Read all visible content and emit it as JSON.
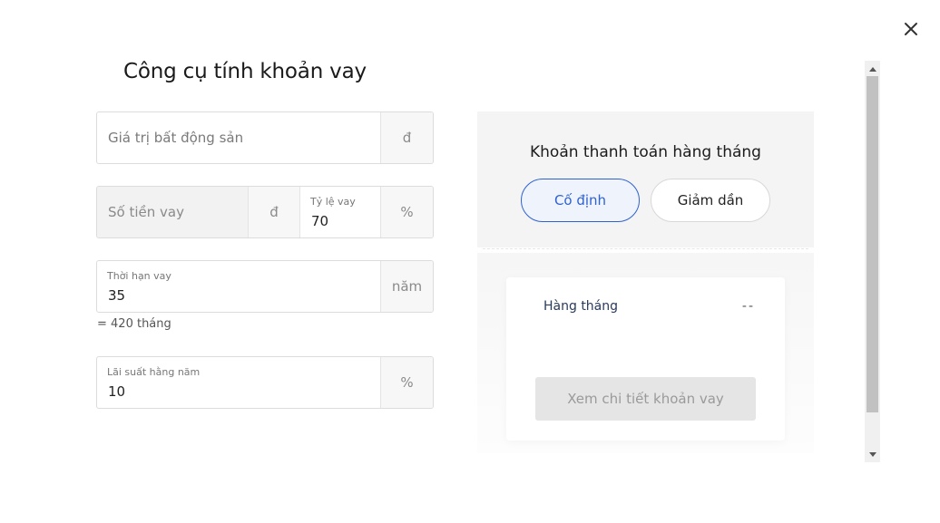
{
  "dialog": {
    "title": "Công cụ tính khoản vay",
    "close_icon": "close-icon"
  },
  "form": {
    "property_value": {
      "placeholder": "Giá trị bất động sản",
      "unit": "đ"
    },
    "loan_amount": {
      "placeholder": "Số tiền vay",
      "unit": "đ"
    },
    "loan_ratio": {
      "label": "Tỷ lệ vay",
      "value": "70",
      "unit": "%"
    },
    "loan_term": {
      "label": "Thời hạn vay",
      "value": "35",
      "unit": "năm",
      "note": "= 420 tháng"
    },
    "interest_rate": {
      "label": "Lãi suất hằng năm",
      "value": "10",
      "unit": "%"
    }
  },
  "result": {
    "heading": "Khoản thanh toán hàng tháng",
    "options": [
      {
        "label": "Cố định",
        "active": true
      },
      {
        "label": "Giảm dần",
        "active": false
      }
    ],
    "monthly_label": "Hàng tháng",
    "monthly_value": "--",
    "detail_button": "Xem chi tiết khoản vay"
  },
  "colors": {
    "accent": "#2f62cf",
    "panel_bg": "#f4f4f4",
    "disabled_button": "#e5e5e5"
  }
}
